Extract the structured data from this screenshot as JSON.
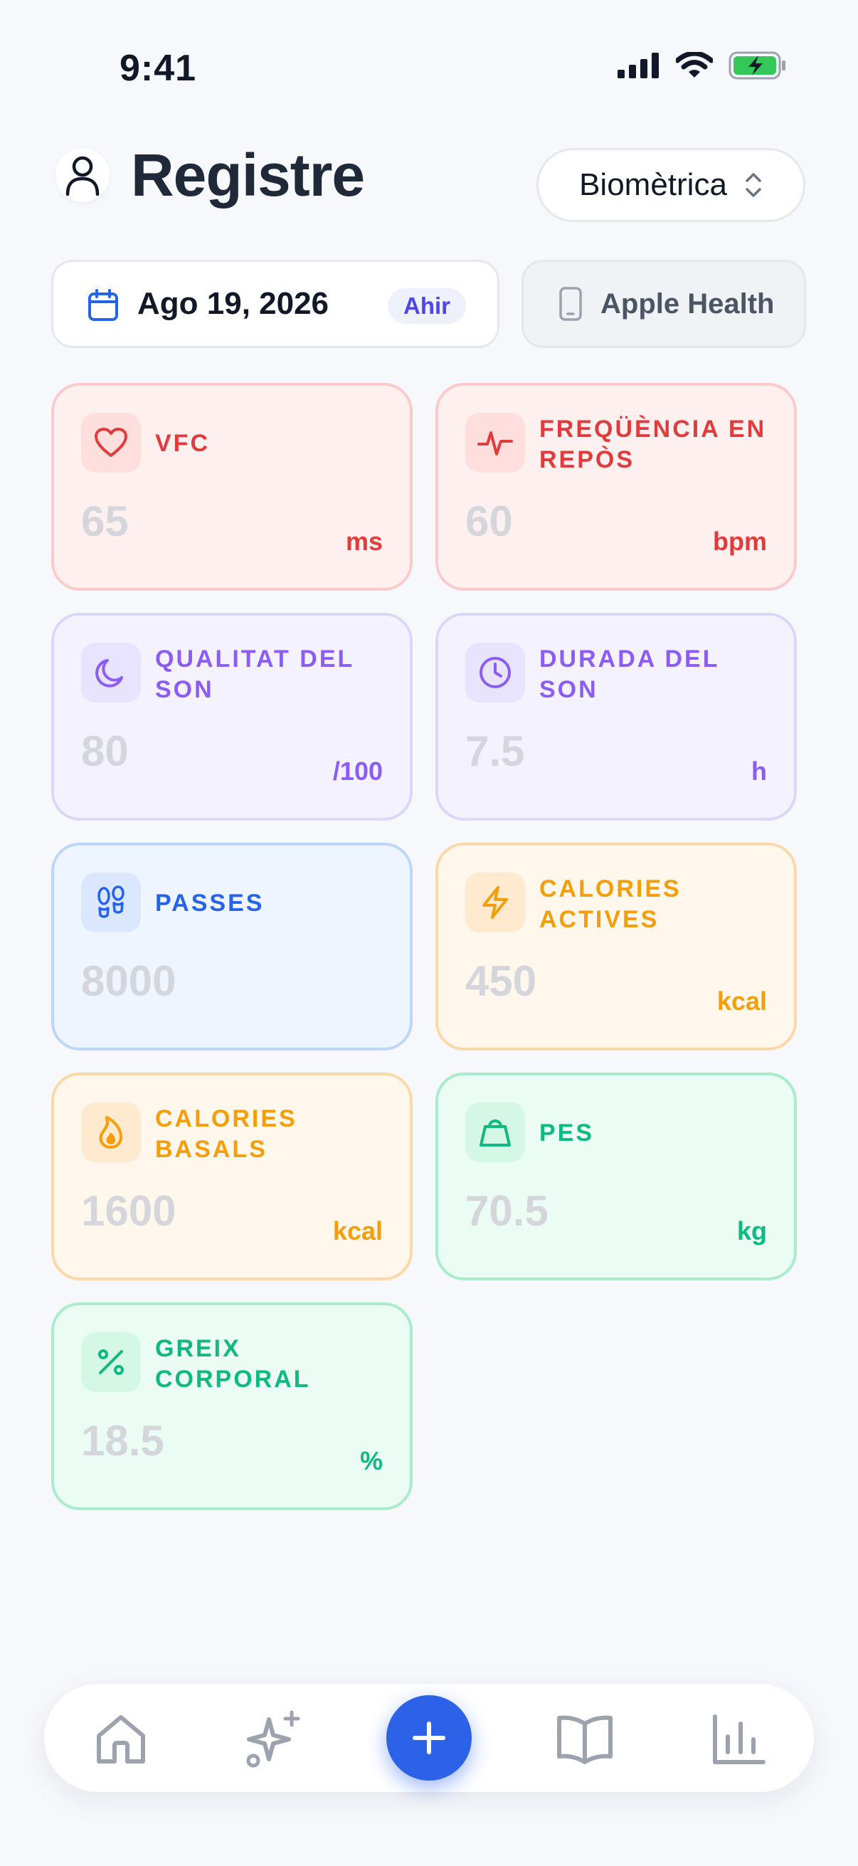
{
  "status_bar": {
    "time": "9:41"
  },
  "header": {
    "title": "Registre",
    "type_selector": "Biomètrica"
  },
  "date_bar": {
    "date": "Ago 19, 2026",
    "relative_badge": "Ahir",
    "source": "Apple Health"
  },
  "metrics": [
    {
      "label": "VFC",
      "value": "65",
      "unit": "ms",
      "icon": "heart-icon",
      "color": "#e23b3b"
    },
    {
      "label": "FREQÜÈNCIA EN REPÒS",
      "value": "60",
      "unit": "bpm",
      "icon": "activity-icon",
      "color": "#e23b3b"
    },
    {
      "label": "QUALITAT DEL SON",
      "value": "80",
      "unit": "/100",
      "icon": "moon-icon",
      "color": "#8b5cf6"
    },
    {
      "label": "DURADA DEL SON",
      "value": "7.5",
      "unit": "h",
      "icon": "clock-icon",
      "color": "#8b5cf6"
    },
    {
      "label": "PASSES",
      "value": "8000",
      "unit": "",
      "icon": "footprints-icon",
      "color": "#2563eb"
    },
    {
      "label": "CALORIES ACTIVES",
      "value": "450",
      "unit": "kcal",
      "icon": "lightning-icon",
      "color": "#f59e0b"
    },
    {
      "label": "CALORIES BASALS",
      "value": "1600",
      "unit": "kcal",
      "icon": "flame-icon",
      "color": "#f59e0b"
    },
    {
      "label": "PES",
      "value": "70.5",
      "unit": "kg",
      "icon": "scale-weight-icon",
      "color": "#10b981"
    },
    {
      "label": "GREIX CORPORAL",
      "value": "18.5",
      "unit": "%",
      "icon": "percent-icon",
      "color": "#10b981"
    }
  ],
  "bottom_nav": {
    "items": [
      "home-icon",
      "sparkles-icon",
      "plus-icon",
      "book-icon",
      "bar-chart-icon"
    ],
    "accent": "#2b62e8"
  }
}
